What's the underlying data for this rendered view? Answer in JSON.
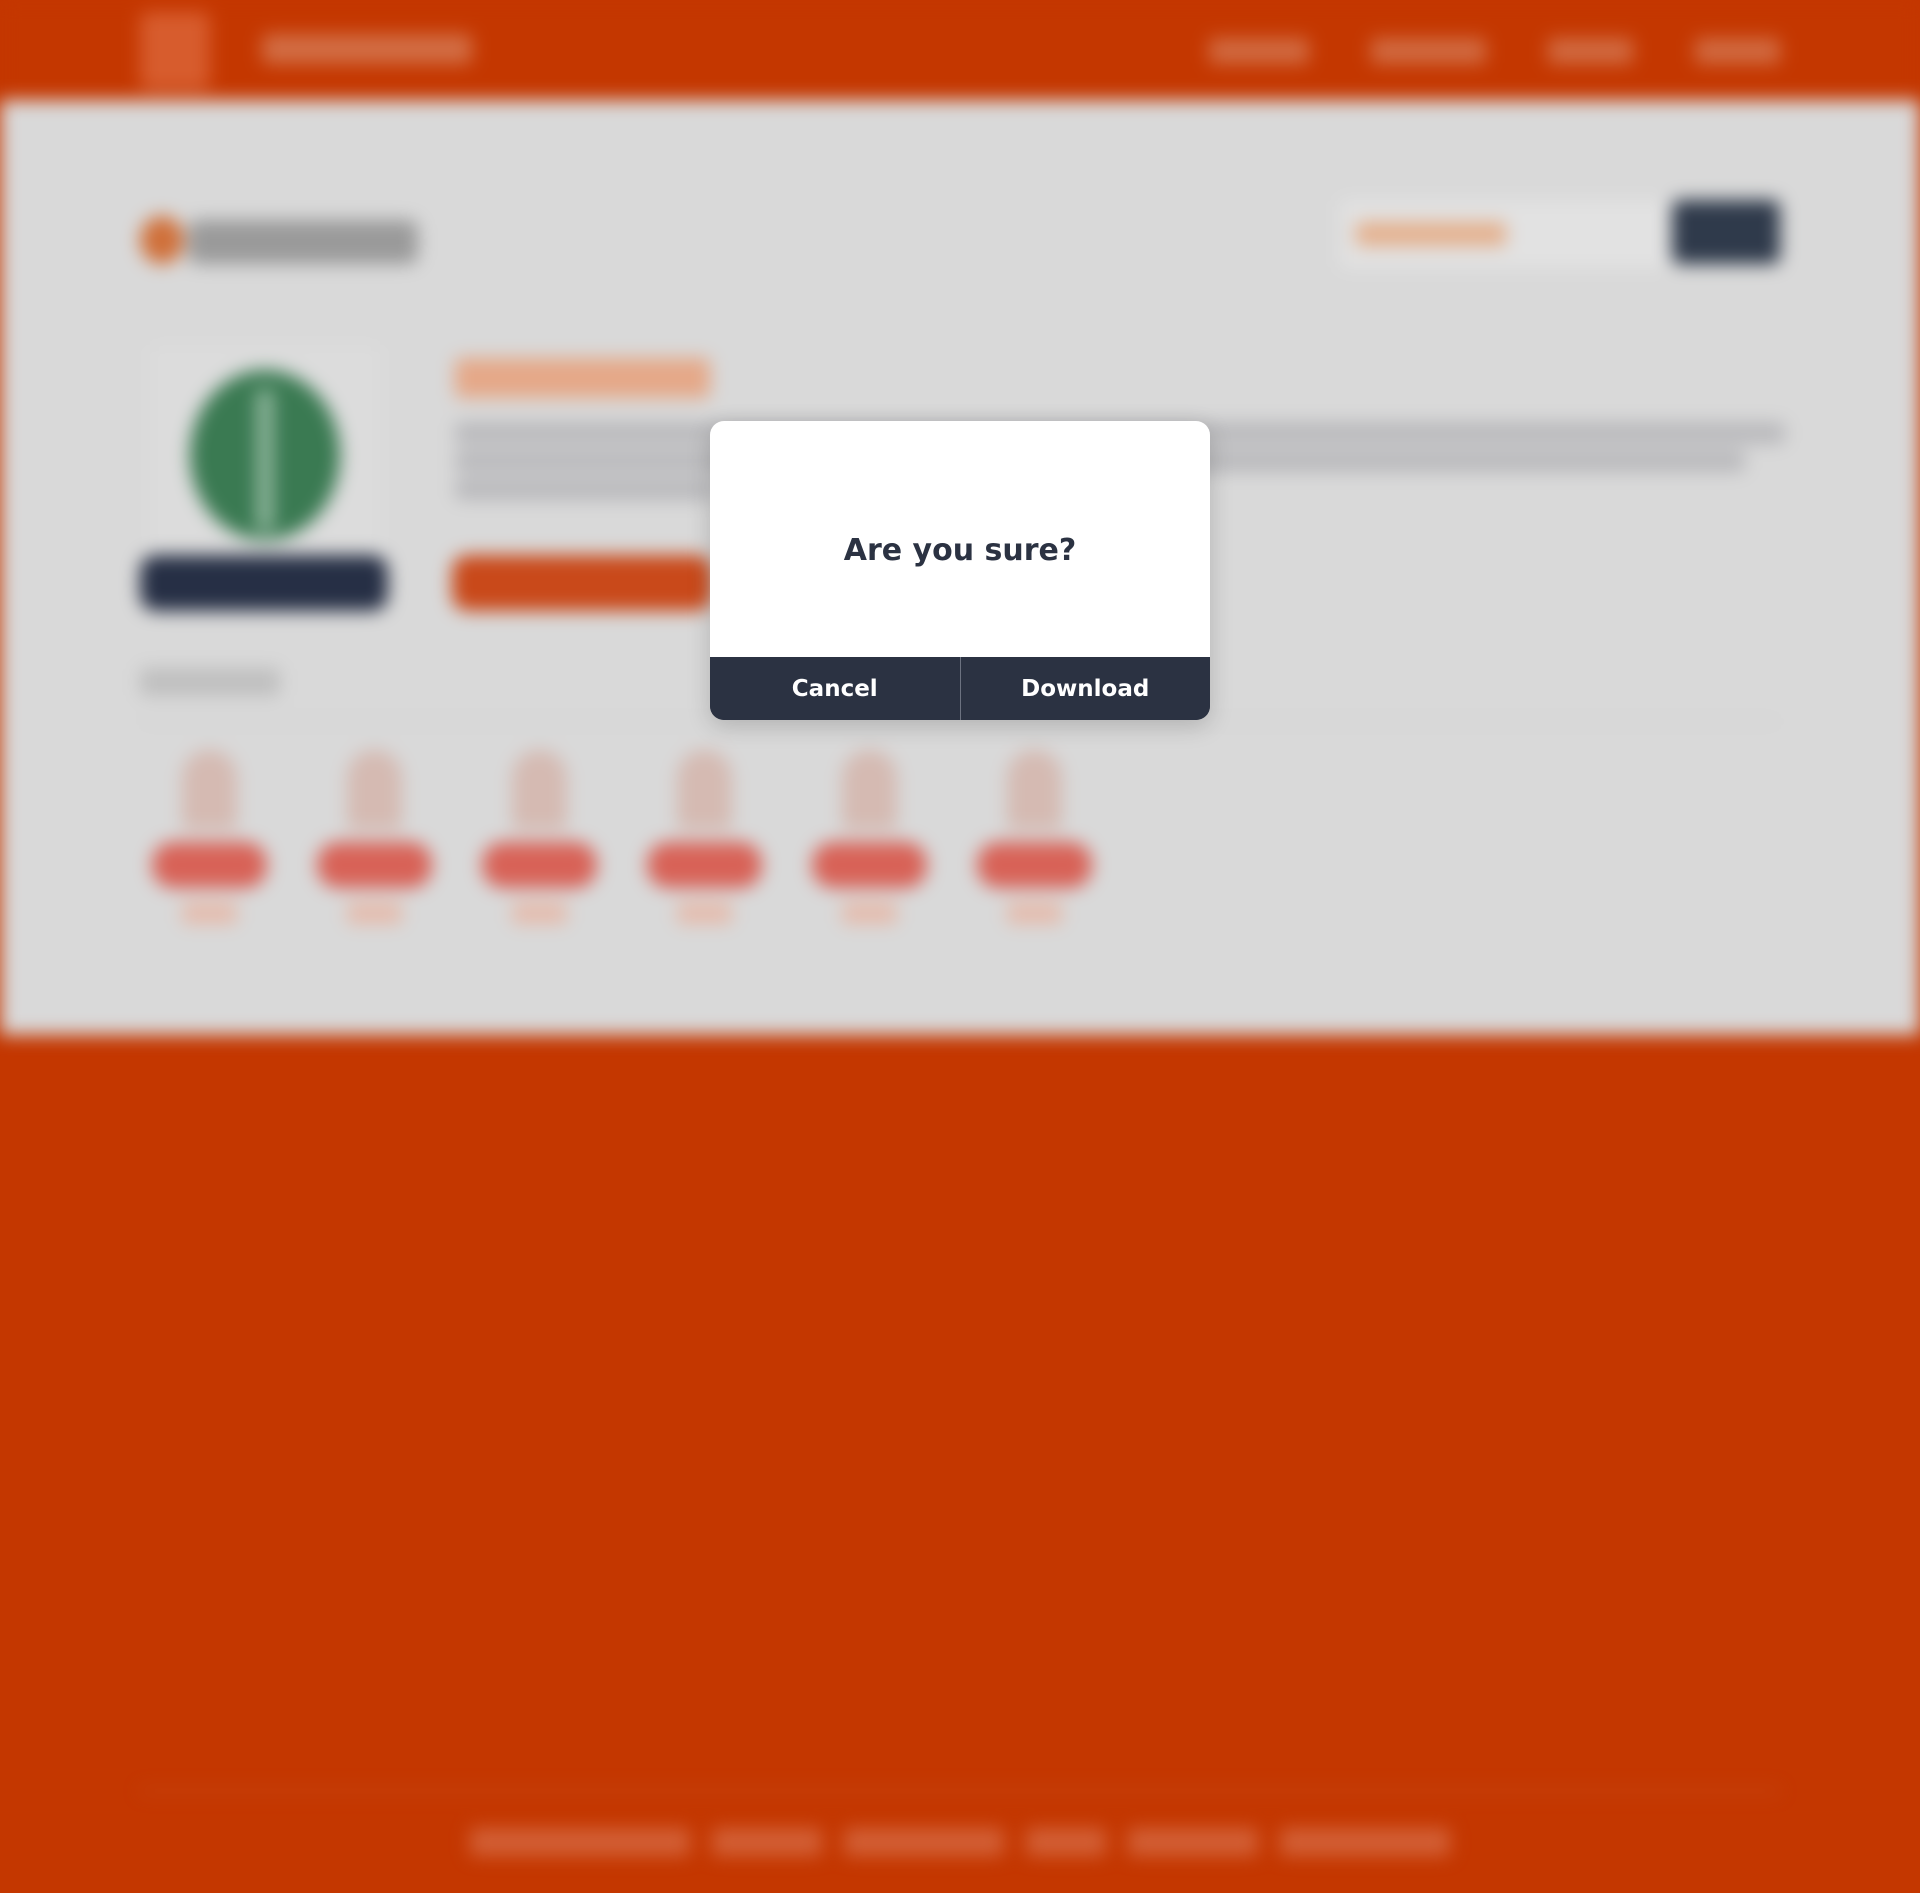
{
  "dialog": {
    "title": "Are you sure?",
    "cancel_label": "Cancel",
    "confirm_label": "Download"
  },
  "colors": {
    "brand": "#c43700",
    "dialog_button_bg": "#2b3242",
    "dialog_title": "#2b3242",
    "page_bg": "#d9d9d9"
  }
}
